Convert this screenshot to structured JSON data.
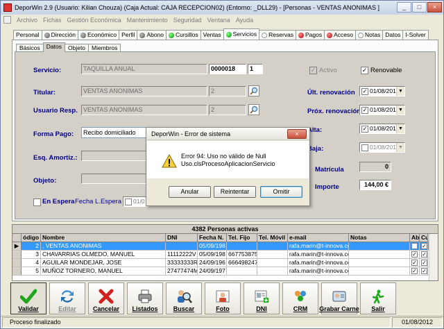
{
  "window": {
    "title": "DeporWin 2.9  (Usuario: Kilian Chouza)  (Caja Actual: CAJA RECEPCION02) (Entorno: _DLL29) - [Personas - VENTAS ANONIMAS  ]",
    "min": "_",
    "max": "□",
    "close": "×"
  },
  "menu": [
    "Archivo",
    "Fichas",
    "Gestión Económica",
    "Mantenimiento",
    "Seguridad",
    "Ventana",
    "Ayuda"
  ],
  "main_tabs": [
    {
      "label": "Personal",
      "dot": ""
    },
    {
      "label": "Dirección",
      "dot": "gray"
    },
    {
      "label": "Económico",
      "dot": "gray"
    },
    {
      "label": "Perfil",
      "dot": ""
    },
    {
      "label": "Abono",
      "dot": "gray"
    },
    {
      "label": "Cursillos",
      "dot": "green"
    },
    {
      "label": "Ventas",
      "dot": ""
    },
    {
      "label": "Servicios",
      "dot": "green"
    },
    {
      "label": "Reservas",
      "dot": "white"
    },
    {
      "label": "Pagos",
      "dot": "red"
    },
    {
      "label": "Acceso",
      "dot": "red"
    },
    {
      "label": "Notas",
      "dot": "white"
    },
    {
      "label": "Datos",
      "dot": ""
    },
    {
      "label": "I-Solver",
      "dot": ""
    }
  ],
  "sub_tabs": [
    "Básicos",
    "Datos",
    "Objeto",
    "Miembros"
  ],
  "form": {
    "servicio_label": "Servicio:",
    "servicio_value": "TAQUILLA ANUAL",
    "servicio_code": "0000018",
    "servicio_num": "1",
    "activo_label": "Activo",
    "activo_checked": "✓",
    "renovable_label": "Renovable",
    "renovable_checked": "✓",
    "titular_label": "Titular:",
    "titular_value": "VENTAS ANONIMAS",
    "titular_num": "2",
    "ult_renov_label": "Últ. renovación",
    "ult_renov_date": "01/08/201",
    "usuario_label": "Usuario Resp.",
    "usuario_value": "VENTAS ANONIMAS",
    "usuario_num": "2",
    "prox_renov_label": "Próx. renovación",
    "prox_renov_date": "01/08/201",
    "forma_pago_label": "Forma Pago:",
    "forma_pago_value": "Recibo domiciliado",
    "alta_label": "Alta:",
    "alta_date": "01/08/201",
    "esq_label": "Esq. Amortiz.:",
    "baja_label": "Baja:",
    "baja_date": "01/08/201",
    "matricula_label": "Matrícula",
    "matricula_value": "0",
    "objeto_label": "Objeto:",
    "importe_label": "Importe",
    "importe_value": "144,00 €",
    "espera_label": "En Espera",
    "fecha_espera_label": "Fecha L.Espera",
    "fecha_espera_value": "01/0"
  },
  "grid": {
    "title": "4382 Personas activas",
    "headers": [
      "ódigo",
      "Nombre",
      "DNI",
      "Fecha N.",
      "Tel. Fijo",
      "Tel. Móvil",
      "e-mail",
      "Notas",
      "Abo",
      "Cu"
    ],
    "rows": [
      {
        "codigo": "2",
        "nombre": ", VENTAS ANONIMAS",
        "dni": "",
        "fecha": "05/09/198",
        "fijo": "",
        "movil": "",
        "email": "rafa.marin@t-innova.co",
        "notas": "",
        "abo": "",
        "cu": "✓"
      },
      {
        "codigo": "3",
        "nombre": "CHAVARRIAS OLMEDO, MANUEL",
        "dni": "11112222V",
        "fecha": "05/09/198",
        "fijo": "667753875",
        "movil": "",
        "email": "rafa.marin@t-innova.co",
        "notas": "",
        "abo": "✓",
        "cu": "✓"
      },
      {
        "codigo": "4",
        "nombre": "AGUILAR MONDEJAR, JOSE",
        "dni": "33333333R",
        "fecha": "24/09/196",
        "fijo": "666498247",
        "movil": "",
        "email": "rafa.marin@t-innova.co",
        "notas": "",
        "abo": "✓",
        "cu": "✓"
      },
      {
        "codigo": "5",
        "nombre": "MUÑOZ TORNERO, MANUEL",
        "dni": "27477474M",
        "fecha": "24/09/197",
        "fijo": "",
        "movil": "",
        "email": "rafa.marin@t-innova.co",
        "notas": "",
        "abo": "✓",
        "cu": "✓"
      }
    ]
  },
  "toolbar": [
    {
      "label": "Validar",
      "icon": "check-icon",
      "enabled": true
    },
    {
      "label": "Editar",
      "icon": "edit-arrows-icon",
      "enabled": false
    },
    {
      "label": "Cancelar",
      "icon": "x-icon",
      "enabled": true
    },
    {
      "label": "Listados",
      "icon": "printer-icon",
      "enabled": true
    },
    {
      "label": "Buscar",
      "icon": "search-people-icon",
      "enabled": true
    },
    {
      "label": "Foto",
      "icon": "photo-icon",
      "enabled": true
    },
    {
      "label": "DNI",
      "icon": "id-card-icon",
      "enabled": true
    },
    {
      "label": "CRM",
      "icon": "crm-icon",
      "enabled": true
    },
    {
      "label": "Grabar Carne",
      "icon": "card-icon",
      "enabled": true
    },
    {
      "label": "Salir",
      "icon": "exit-icon",
      "enabled": true
    }
  ],
  "status": {
    "message": "Proceso finalizado",
    "date": "01/08/2012"
  },
  "dialog": {
    "title": "DeporWin - Error de sistema",
    "close": "×",
    "line1": "Error 94: Uso no válido de Null",
    "line2": "Uso.clsProcesoAplicacionServicio",
    "btn_anular": "Anular",
    "btn_reintentar": "Reintentar",
    "btn_omitir": "Omitir"
  },
  "colors": {
    "label_blue": "#00008b",
    "selection": "#3399ff",
    "validar_green": "#1fa61f",
    "cancel_red": "#d22020"
  }
}
